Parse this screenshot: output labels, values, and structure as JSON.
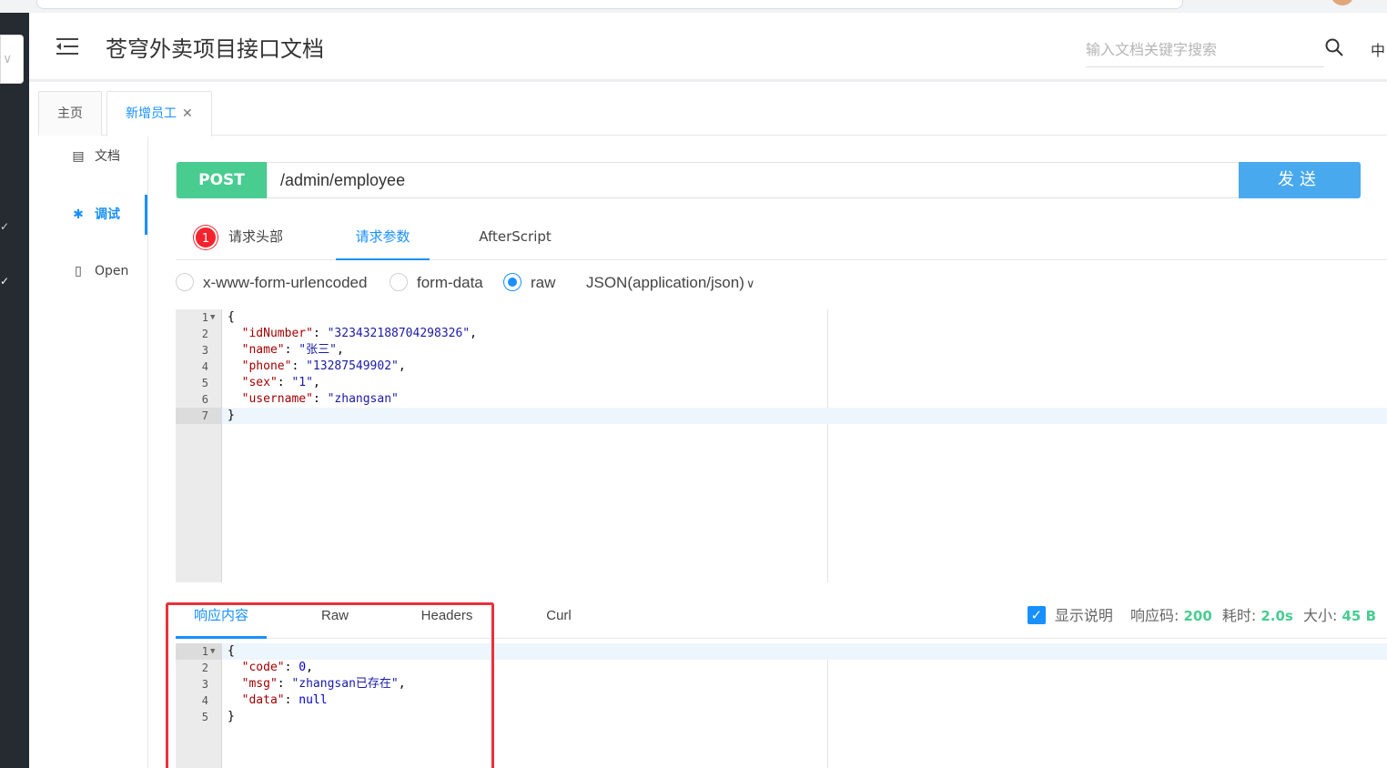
{
  "header": {
    "title": "苍穹外卖项目接口文档",
    "search_placeholder": "输入文档关键字搜索",
    "lang": "中"
  },
  "tabs": [
    {
      "label": "主页"
    },
    {
      "label": "新增员工"
    }
  ],
  "side_nav": [
    {
      "label": "文档",
      "icon": "document-icon"
    },
    {
      "label": "调试",
      "icon": "bug-icon"
    },
    {
      "label": "Open",
      "icon": "file-icon"
    }
  ],
  "request": {
    "method": "POST",
    "url": "/admin/employee",
    "send_label": "发送"
  },
  "request_tabs": {
    "headers_label": "请求头部",
    "headers_badge": "1",
    "params_label": "请求参数",
    "afterscript_label": "AfterScript"
  },
  "body_types": {
    "urlencoded": "x-www-form-urlencoded",
    "formdata": "form-data",
    "raw": "raw",
    "selected": "raw",
    "content_type": "JSON(application/json)"
  },
  "request_body_lines": [
    {
      "num": "1",
      "text": "{"
    },
    {
      "num": "2",
      "key": "\"idNumber\"",
      "value": "\"323432188704298326\"",
      "tail": ","
    },
    {
      "num": "3",
      "key": "\"name\"",
      "value": "\"张三\"",
      "tail": ","
    },
    {
      "num": "4",
      "key": "\"phone\"",
      "value": "\"13287549902\"",
      "tail": ","
    },
    {
      "num": "5",
      "key": "\"sex\"",
      "value": "\"1\"",
      "tail": ","
    },
    {
      "num": "6",
      "key": "\"username\"",
      "value": "\"zhangsan\"",
      "tail": ""
    },
    {
      "num": "7",
      "text": "}"
    }
  ],
  "response_tabs": {
    "content_label": "响应内容",
    "raw_label": "Raw",
    "headers_label": "Headers",
    "curl_label": "Curl"
  },
  "response_meta": {
    "show_desc_label": "显示说明",
    "code_label": "响应码:",
    "code_value": "200",
    "time_label": "耗时:",
    "time_value": "2.0s",
    "size_label": "大小:",
    "size_value": "45 B"
  },
  "response_body_lines": [
    {
      "num": "1",
      "text": "{"
    },
    {
      "num": "2",
      "key": "\"code\"",
      "value": "0",
      "tail": ","
    },
    {
      "num": "3",
      "key": "\"msg\"",
      "value": "\"zhangsan已存在\"",
      "tail": ","
    },
    {
      "num": "4",
      "key": "\"data\"",
      "value": "null",
      "tail": ""
    },
    {
      "num": "5",
      "text": "}"
    }
  ],
  "colors": {
    "accent": "#1890ff",
    "post_method": "#49cc90",
    "send_button": "#49a9ee",
    "highlight_box": "#e8323c"
  }
}
